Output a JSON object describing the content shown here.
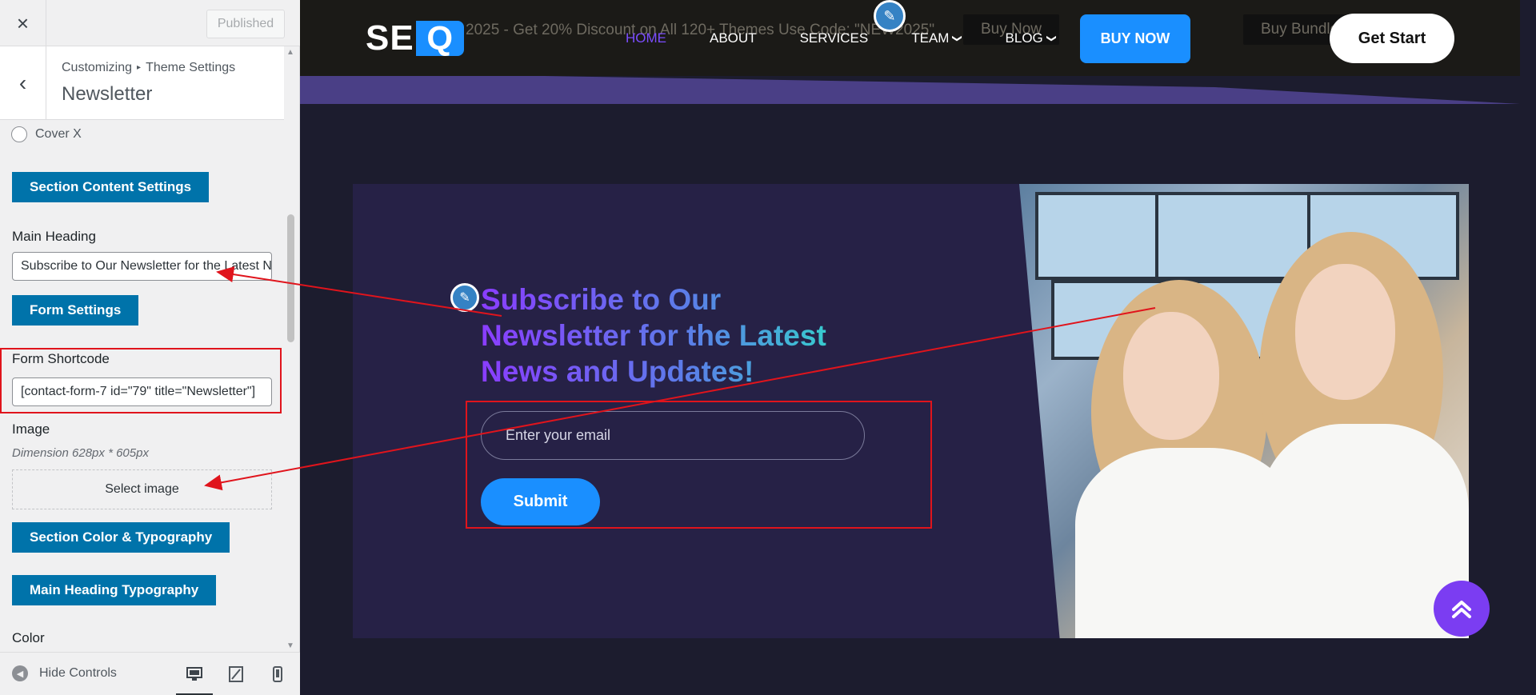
{
  "sidebar": {
    "close_icon": "×",
    "published_label": "Published",
    "back_icon": "‹",
    "breadcrumb": {
      "root": "Customizing",
      "separator": "▸",
      "parent": "Theme Settings"
    },
    "title": "Newsletter",
    "radio_option": "Cover X",
    "section_content_button": "Section Content Settings",
    "main_heading_label": "Main Heading",
    "main_heading_value": "Subscribe to Our Newsletter for the Latest News and Updates!",
    "form_settings_button": "Form Settings",
    "form_shortcode_label": "Form Shortcode",
    "form_shortcode_value": "[contact-form-7 id=\"79\" title=\"Newsletter\"]",
    "image_label": "Image",
    "image_dimension": "Dimension 628px * 605px",
    "select_image_button": "Select image",
    "color_typography_button": "Section Color & Typography",
    "heading_typography_button": "Main Heading Typography",
    "color_label": "Color",
    "hide_controls_label": "Hide Controls"
  },
  "preview": {
    "promo_text": "2025 - Get 20% Discount on All 120+ Themes Use Code: \"NEW2025\"",
    "promo_buttons": [
      "Buy Now",
      "Buy Bundle"
    ],
    "logo": {
      "text": "SE",
      "accent": "Q"
    },
    "nav": [
      {
        "label": "HOME",
        "active": true
      },
      {
        "label": "ABOUT"
      },
      {
        "label": "SERVICES"
      },
      {
        "label": "TEAM",
        "dropdown": true
      },
      {
        "label": "BLOG",
        "dropdown": true
      }
    ],
    "buy_now": "BUY NOW",
    "get_start": "Get Start",
    "newsletter_title": "Subscribe to Our Newsletter for the Latest News and Updates!",
    "email_placeholder": "Enter your email",
    "submit_label": "Submit",
    "to_top_icon": "double-chevron-up-icon"
  },
  "colors": {
    "wp_blue": "#0073aa",
    "brand_blue": "#1a8fff",
    "purple": "#7b3df2",
    "annotation_red": "#e0141c",
    "section_bg": "#262146"
  }
}
